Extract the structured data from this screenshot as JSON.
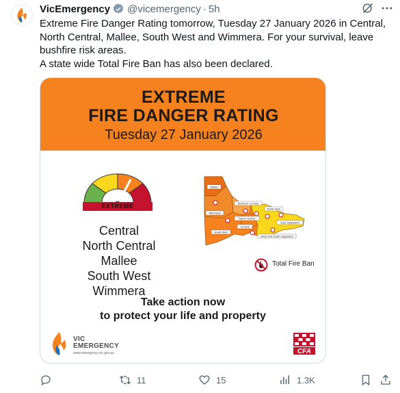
{
  "tweet": {
    "author_name": "VicEmergency",
    "handle": "@vicemergency",
    "separator": "·",
    "time": "5h",
    "text_lines": [
      "Extreme Fire Danger Rating tomorrow, Tuesday 27 January 2026 in Central,",
      "North Central, Mallee, South West and Wimmera. For your survival, leave",
      "bushfire risk areas.",
      "A state wide Total Fire Ban has also been declared."
    ]
  },
  "media": {
    "banner": {
      "line1": "EXTREME",
      "line2": "FIRE DANGER RATING",
      "date": "Tuesday 27 January 2026"
    },
    "gauge_label": "EXTREME",
    "districts": [
      "Central",
      "North Central",
      "Mallee",
      "South West",
      "Wimmera"
    ],
    "map_labels": {
      "mallee": "Mallee",
      "wimmera": "Wimmera",
      "south_west": "South West",
      "northern_country": "Northern Country",
      "north_central": "North Central",
      "central": "Central",
      "north_east": "North East",
      "east_gippsland": "East Gippsland",
      "west_south_gippsland": "West and South Gippsland"
    },
    "tfb_label": "Total Fire Ban",
    "action_line1": "Take action now",
    "action_line2": "to protect your life and property",
    "logo_line1": "VIC",
    "logo_line2": "EMERGENCY",
    "logo_url": "www.emergency.vic.gov.au",
    "cfa_text": "CFA"
  },
  "actions": {
    "replies": "",
    "reposts": "11",
    "likes": "15",
    "views": "1.3K"
  },
  "colors": {
    "banner_orange": "#f5821f",
    "extreme_red": "#c4122f",
    "text_primary": "#0f1419",
    "text_secondary": "#536471"
  },
  "icons": [
    "vicemergency-flame-icon",
    "verified-badge-icon",
    "grok-icon",
    "more-icon",
    "reply-icon",
    "repost-icon",
    "like-icon",
    "views-icon",
    "bookmark-icon",
    "share-icon",
    "no-fire-icon",
    "cfa-logo-icon"
  ]
}
